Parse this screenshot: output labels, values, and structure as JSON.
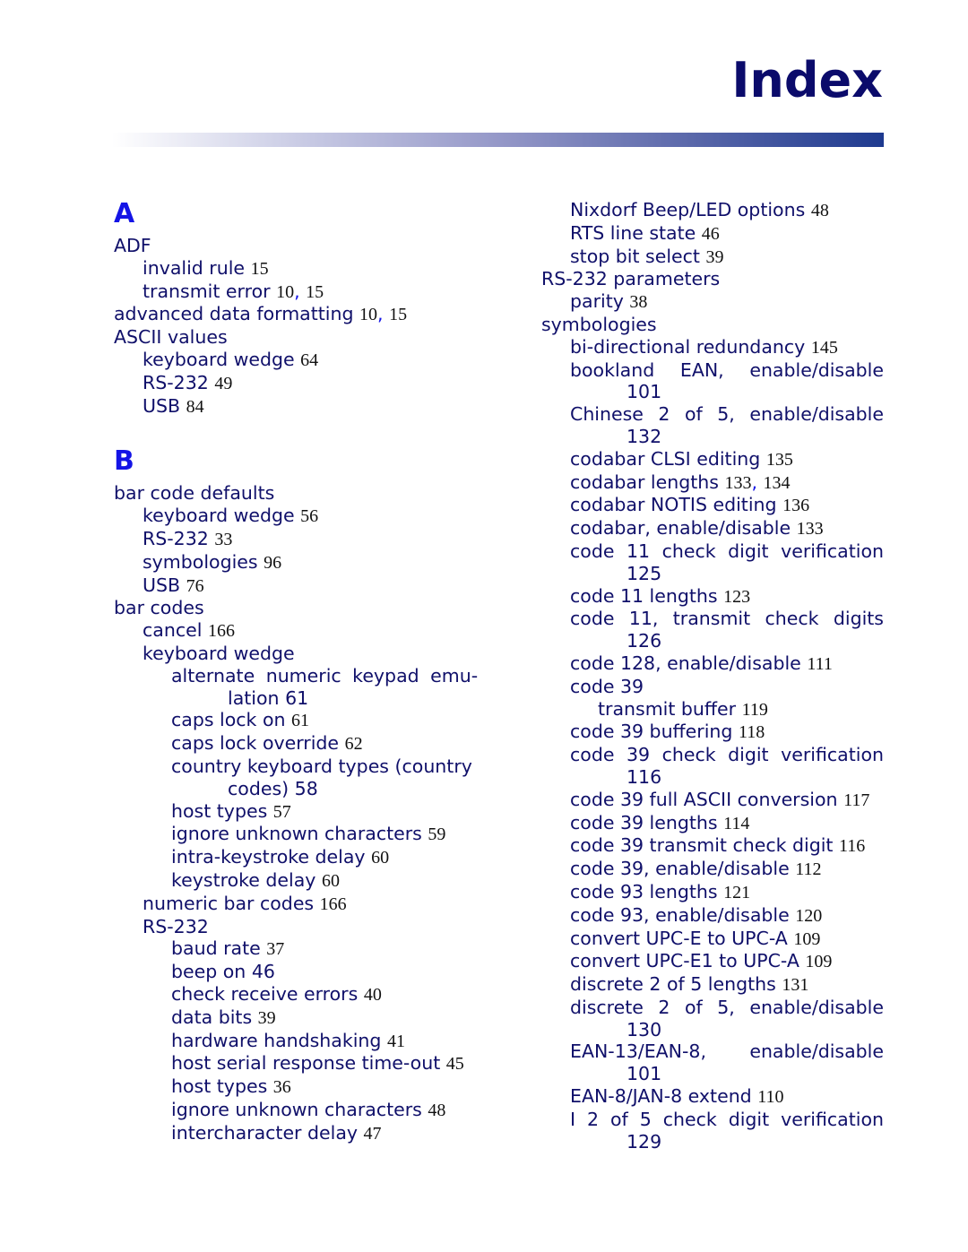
{
  "header": {
    "title": "Index"
  },
  "left": {
    "sectionA": "A",
    "sectionB": "B",
    "a": [
      {
        "t": "ADF"
      },
      {
        "t": "invalid rule",
        "p": "15"
      },
      {
        "t": "transmit error",
        "p1": "10",
        "p2": "15"
      },
      {
        "t": "advanced data formatting",
        "p1": "10",
        "p2": "15"
      },
      {
        "t": "ASCII values"
      },
      {
        "t": "keyboard wedge",
        "p": "64"
      },
      {
        "t": "RS-232",
        "p": "49"
      },
      {
        "t": "USB",
        "p": "84"
      }
    ],
    "b": [
      {
        "t": "bar code defaults"
      },
      {
        "t": "keyboard wedge",
        "p": "56"
      },
      {
        "t": "RS-232",
        "p": "33"
      },
      {
        "t": "symbologies",
        "p": "96"
      },
      {
        "t": "USB",
        "p": "76"
      },
      {
        "t": "bar codes"
      },
      {
        "t": "cancel",
        "p": "166"
      },
      {
        "t": "keyboard wedge"
      },
      {
        "t": "alternate numeric keypad emu-",
        "t2": "lation",
        "p": "61"
      },
      {
        "t": "caps lock on",
        "p": "61"
      },
      {
        "t": "caps lock override",
        "p": "62"
      },
      {
        "t": "country keyboard types (country",
        "t2": "codes)",
        "p": "58"
      },
      {
        "t": "host types",
        "p": "57"
      },
      {
        "t": "ignore unknown characters",
        "p": "59"
      },
      {
        "t": "intra-keystroke delay",
        "p": "60"
      },
      {
        "t": "keystroke delay",
        "p": "60"
      },
      {
        "t": "numeric bar codes",
        "p": "166"
      },
      {
        "t": "RS-232"
      },
      {
        "t": "baud rate",
        "p": "37"
      },
      {
        "t": "beep on 46"
      },
      {
        "t": "check receive errors",
        "p": "40"
      },
      {
        "t": "data bits",
        "p": "39"
      },
      {
        "t": "hardware handshaking",
        "p": "41"
      },
      {
        "t": "host serial response time-out",
        "p": "45"
      },
      {
        "t": "host types",
        "p": "36"
      },
      {
        "t": "ignore unknown characters",
        "p": "48"
      },
      {
        "t": "intercharacter delay",
        "p": "47"
      }
    ]
  },
  "right": [
    {
      "t": "Nixdorf Beep/LED options",
      "p": "48"
    },
    {
      "t": "RTS line state",
      "p": "46"
    },
    {
      "t": "stop bit select",
      "p": "39"
    },
    {
      "t": "RS-232 parameters"
    },
    {
      "t": "parity",
      "p": "38"
    },
    {
      "t": "symbologies"
    },
    {
      "t": "bi-directional redundancy",
      "p": "145"
    },
    {
      "t": "bookland EAN, enable/disable",
      "p": "101"
    },
    {
      "t": "Chinese 2 of 5, enable/disable",
      "p": "132"
    },
    {
      "t": "codabar CLSI editing",
      "p": "135"
    },
    {
      "t": "codabar lengths",
      "p1": "133",
      "p2": "134"
    },
    {
      "t": "codabar NOTIS editing",
      "p": "136"
    },
    {
      "t": "codabar, enable/disable",
      "p": "133"
    },
    {
      "t": "code 11 check digit verification",
      "p": "125"
    },
    {
      "t": "code 11 lengths",
      "p": "123"
    },
    {
      "t": "code 11, transmit check digits",
      "p": "126"
    },
    {
      "t": "code 128, enable/disable",
      "p": "111"
    },
    {
      "t": "code 39"
    },
    {
      "t": "transmit buffer",
      "p": "119"
    },
    {
      "t": "code 39 buffering",
      "p": "118"
    },
    {
      "t": "code 39 check digit verification",
      "p": "116"
    },
    {
      "t": "code 39 full ASCII conversion",
      "p": "117"
    },
    {
      "t": "code 39 lengths",
      "p": "114"
    },
    {
      "t": "code 39 transmit check digit",
      "p": "116"
    },
    {
      "t": "code 39, enable/disable",
      "p": "112"
    },
    {
      "t": "code 93 lengths",
      "p": "121"
    },
    {
      "t": "code 93, enable/disable",
      "p": "120"
    },
    {
      "t": "convert UPC-E to UPC-A",
      "p": "109"
    },
    {
      "t": "convert UPC-E1 to UPC-A",
      "p": "109"
    },
    {
      "t": "discrete 2 of 5 lengths",
      "p": "131"
    },
    {
      "t": "discrete 2 of 5, enable/disable",
      "p": "130"
    },
    {
      "t": "EAN-13/EAN-8, enable/disable",
      "p": "101"
    },
    {
      "t": "EAN-8/JAN-8 extend",
      "p": "110"
    },
    {
      "t": "I 2 of 5 check digit verification",
      "p": "129"
    }
  ]
}
